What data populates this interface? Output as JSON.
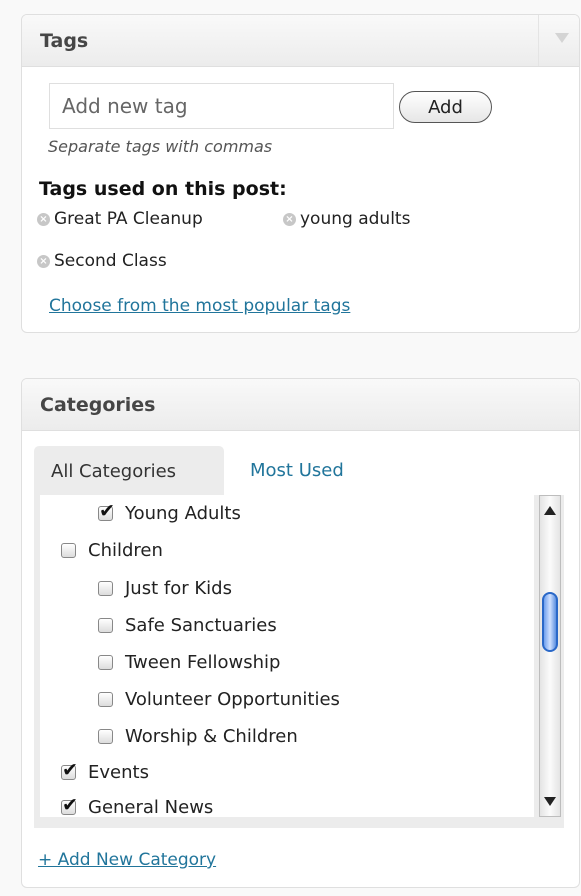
{
  "tags": {
    "title": "Tags",
    "input_placeholder": "Add new tag",
    "add_label": "Add",
    "hint": "Separate tags with commas",
    "used_title": "Tags used on this post:",
    "used": [
      "Great PA Cleanup",
      "young adults",
      "Second Class"
    ],
    "popular_link": "Choose from the most popular tags"
  },
  "categories": {
    "title": "Categories",
    "tab_all": "All Categories",
    "tab_used": "Most Used",
    "items": [
      {
        "label": "Young Adults",
        "checked": true
      },
      {
        "label": "Children",
        "checked": false
      },
      {
        "label": "Just for Kids",
        "checked": false
      },
      {
        "label": "Safe Sanctuaries",
        "checked": false
      },
      {
        "label": "Tween Fellowship",
        "checked": false
      },
      {
        "label": "Volunteer Opportunities",
        "checked": false
      },
      {
        "label": "Worship & Children",
        "checked": false
      },
      {
        "label": "Events",
        "checked": true
      },
      {
        "label": "General News",
        "checked": true
      }
    ],
    "add_link": "+ Add New Category"
  },
  "icons": [
    "collapse-arrow-icon",
    "remove-tag-icon",
    "scroll-up-icon",
    "scroll-down-icon"
  ],
  "colors": {
    "link": "#21759b",
    "scroll_thumb": "#2a68c8"
  }
}
